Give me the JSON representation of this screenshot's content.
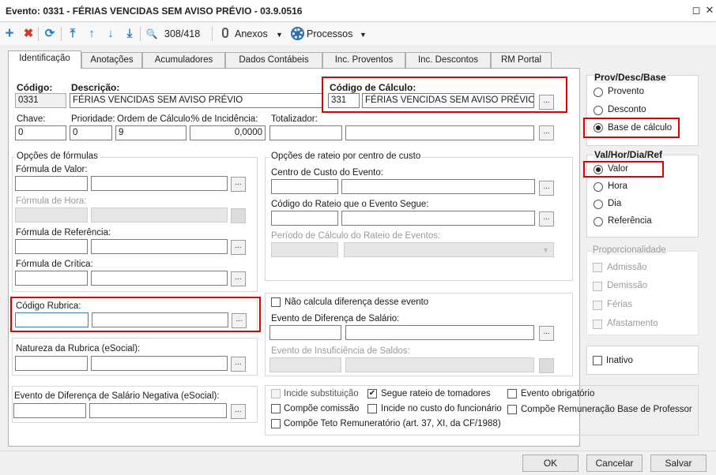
{
  "window": {
    "title": "Evento: 0331 - FÉRIAS VENCIDAS SEM AVISO PRÉVIO - 03.9.0516",
    "restore": "◻",
    "close": "✕"
  },
  "toolbar": {
    "add": "+",
    "delete": "✖",
    "refresh": "⟳",
    "first": "⤒",
    "prev": "↑",
    "next": "↓",
    "last": "⤓",
    "search": "🔍",
    "record_count": "308/418",
    "attachments": "Anexos",
    "processes": "Processos",
    "caret": "▼"
  },
  "tabs": [
    "Identificação",
    "Anotações",
    "Acumuladores",
    "Dados Contábeis",
    "Inc. Proventos",
    "Inc. Descontos",
    "RM Portal"
  ],
  "form": {
    "codigo_label": "Código:",
    "codigo": "0331",
    "descricao_label": "Descrição:",
    "descricao": "FÉRIAS VENCIDAS SEM AVISO PRÉVIO",
    "codigo_calculo_label": "Código de Cálculo:",
    "codigo_calculo": "331",
    "codigo_calculo_desc": "FÉRIAS VENCIDAS SEM AVISO PRÉVIO",
    "chave_label": "Chave:",
    "chave": "0",
    "prioridade_label": "Prioridade:",
    "prioridade": "0",
    "ordem_label": "Ordem de Cálculo:",
    "ordem": "9",
    "incidencia_label": "% de Incidência:",
    "incidencia": "0,0000",
    "totalizador_label": "Totalizador:",
    "dots": "..."
  },
  "formulas": {
    "title": "Opções de fórmulas",
    "valor": "Fórmula de Valor:",
    "hora": "Fórmula de Hora:",
    "referencia": "Fórmula de Referência:",
    "critica": "Fórmula de Crítica:"
  },
  "rateio": {
    "title": "Opções de rateio por centro de custo",
    "centro": "Centro de Custo do Evento:",
    "codigo_rateio": "Código do Rateio que o Evento Segue:",
    "periodo": "Período de Cálculo do Rateio de Eventos:"
  },
  "rubrica": {
    "label": "Código Rubrica:"
  },
  "natureza": {
    "label": "Natureza da Rubrica (eSocial):"
  },
  "diferenca": {
    "nao_calcula": "Não calcula diferença desse evento",
    "evento_diferenca": "Evento de Diferença de Salário:",
    "evento_insuficiencia": "Evento de Insuficiência de Saldos:"
  },
  "negativa": {
    "label": "Evento de Diferença de Salário Negativa (eSocial):"
  },
  "checks": {
    "incide_substituicao": "Incide substituição",
    "segue_rateio": "Segue rateio de tomadores",
    "evento_obrigatorio": "Evento obrigatório",
    "compoe_comissao": "Compõe comissão",
    "incide_custo": "Incide no custo do funcionário",
    "compoe_remuneracao": "Compõe Remuneração Base de Professor",
    "compoe_teto": "Compõe Teto Remuneratório (art. 37, XI, da CF/1988)",
    "check_mark": "✔"
  },
  "prov_desc": {
    "title": "Prov/Desc/Base",
    "options": [
      "Provento",
      "Desconto",
      "Base de cálculo"
    ],
    "selected": "Base de cálculo"
  },
  "val_hor": {
    "title": "Val/Hor/Dia/Ref",
    "options": [
      "Valor",
      "Hora",
      "Dia",
      "Referência"
    ],
    "selected": "Valor"
  },
  "proporcionalidade": {
    "title": "Proporcionalidade",
    "options": [
      "Admissão",
      "Demissão",
      "Férias",
      "Afastamento"
    ]
  },
  "inativo": "Inativo",
  "buttons": {
    "ok": "OK",
    "cancelar": "Cancelar",
    "salvar": "Salvar"
  },
  "colors": {
    "red_highlight": "#e00000",
    "add_icon": "#2b7cc4",
    "delete_icon": "#d23a2a"
  }
}
